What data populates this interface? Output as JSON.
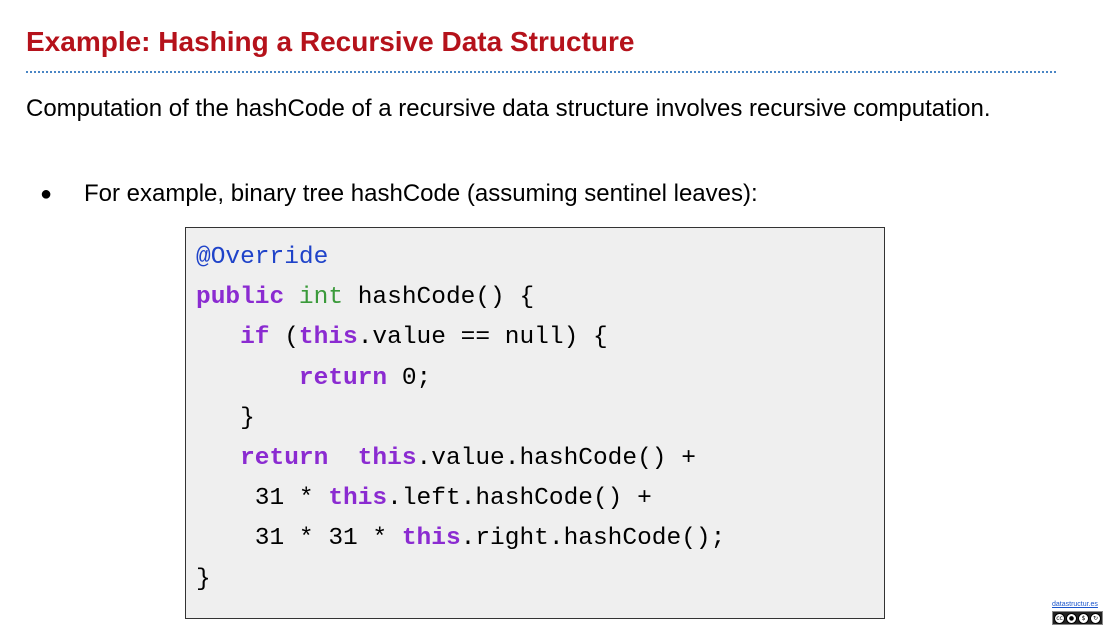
{
  "slide": {
    "title": "Example: Hashing a Recursive Data Structure",
    "intro": "Computation of the hashCode of a recursive data structure involves recursive computation.",
    "bullet": "For example, binary tree hashCode (assuming sentinel leaves):",
    "bullet_marker": "●"
  },
  "code": {
    "lines": [
      [
        {
          "t": "@Override",
          "k": "anno"
        }
      ],
      [
        {
          "t": "public",
          "k": "kw"
        },
        {
          "t": " "
        },
        {
          "t": "int",
          "k": "type"
        },
        {
          "t": " hashCode() {"
        }
      ],
      [
        {
          "t": "   "
        },
        {
          "t": "if",
          "k": "kw"
        },
        {
          "t": " ("
        },
        {
          "t": "this",
          "k": "kw"
        },
        {
          "t": ".value == null) {"
        }
      ],
      [
        {
          "t": "       "
        },
        {
          "t": "return",
          "k": "kw"
        },
        {
          "t": " 0;"
        }
      ],
      [
        {
          "t": "   }"
        }
      ],
      [
        {
          "t": "   "
        },
        {
          "t": "return",
          "k": "kw"
        },
        {
          "t": "  "
        },
        {
          "t": "this",
          "k": "kw"
        },
        {
          "t": ".value.hashCode() +"
        }
      ],
      [
        {
          "t": "    31 * "
        },
        {
          "t": "this",
          "k": "kw"
        },
        {
          "t": ".left.hashCode() +"
        }
      ],
      [
        {
          "t": "    31 * 31 * "
        },
        {
          "t": "this",
          "k": "kw"
        },
        {
          "t": ".right.hashCode();"
        }
      ],
      [
        {
          "t": "}"
        }
      ]
    ],
    "colors": {
      "annotation": "#1f43c9",
      "keyword": "#8b2bd1",
      "type": "#3a9a3a",
      "background": "#efefef"
    }
  },
  "license": {
    "link_text": "datastructur.es",
    "badge": "cc-by-nc-sa-icon"
  },
  "colors": {
    "title": "#b5121b",
    "rule": "#4a86c5"
  }
}
